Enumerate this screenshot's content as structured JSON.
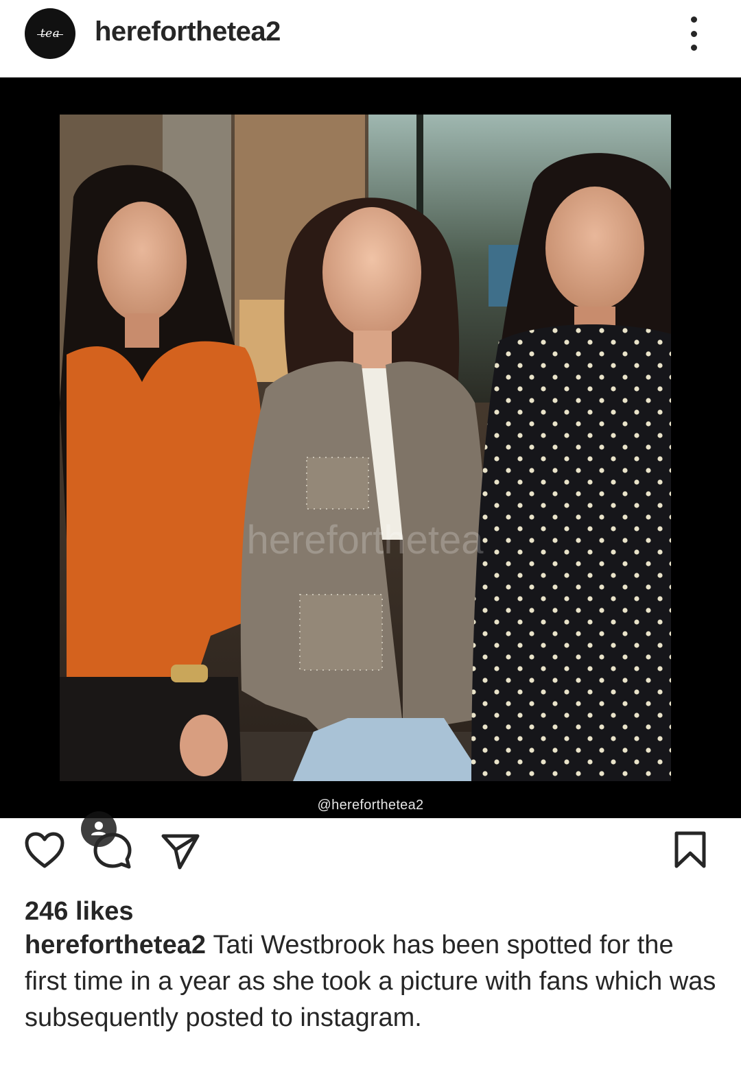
{
  "header": {
    "username": "herefortheteа2",
    "avatar_text": "tea"
  },
  "media": {
    "watermark_handle": "@herefortheteа2",
    "overlay_watermark": "herefortheteа"
  },
  "actions": {
    "icons": [
      "heart-icon",
      "comment-icon",
      "share-icon",
      "bookmark-icon"
    ]
  },
  "likes_text": "246 likes",
  "caption": {
    "username": "herefortheteа2",
    "text": "Tati Westbrook has been spotted for the first time in a year as she took a picture with fans which was subsequently posted to instagram."
  },
  "colors": {
    "text": "#262626",
    "media_background": "#000000",
    "page_background": "#ffffff"
  }
}
